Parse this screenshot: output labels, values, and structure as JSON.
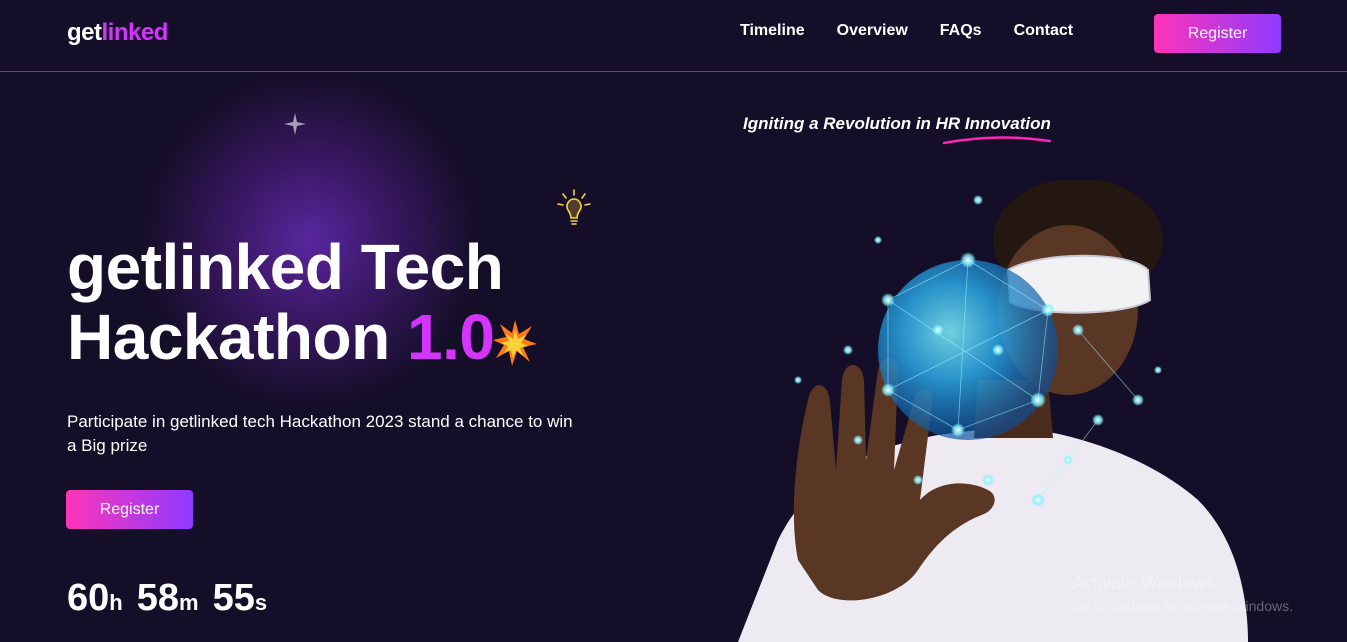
{
  "header": {
    "logo_prefix": "get",
    "logo_accent": "linked",
    "nav": [
      {
        "label": "Timeline"
      },
      {
        "label": "Overview"
      },
      {
        "label": "FAQs"
      },
      {
        "label": "Contact"
      }
    ],
    "register_label": "Register"
  },
  "hero": {
    "tagline": "Igniting a Revolution in HR Innovation",
    "title_line1": "getlinked Tech",
    "title_line2": "Hackathon",
    "title_version": "1.0",
    "description": "Participate in getlinked tech Hackathon 2023 stand a chance to win a Big prize",
    "register_label": "Register",
    "countdown": {
      "hours": "60",
      "hours_unit": "h",
      "minutes": "58",
      "minutes_unit": "m",
      "seconds": "55",
      "seconds_unit": "s"
    }
  },
  "watermark": {
    "title": "Activate Windows",
    "subtitle": "Go to Settings to activate Windows."
  },
  "colors": {
    "background": "#150e28",
    "accent": "#d434fe",
    "button_start": "#fe34b9",
    "button_end": "#903aff"
  },
  "icons": [
    "sparkle-icon",
    "lightbulb-icon",
    "explosion-icon"
  ]
}
